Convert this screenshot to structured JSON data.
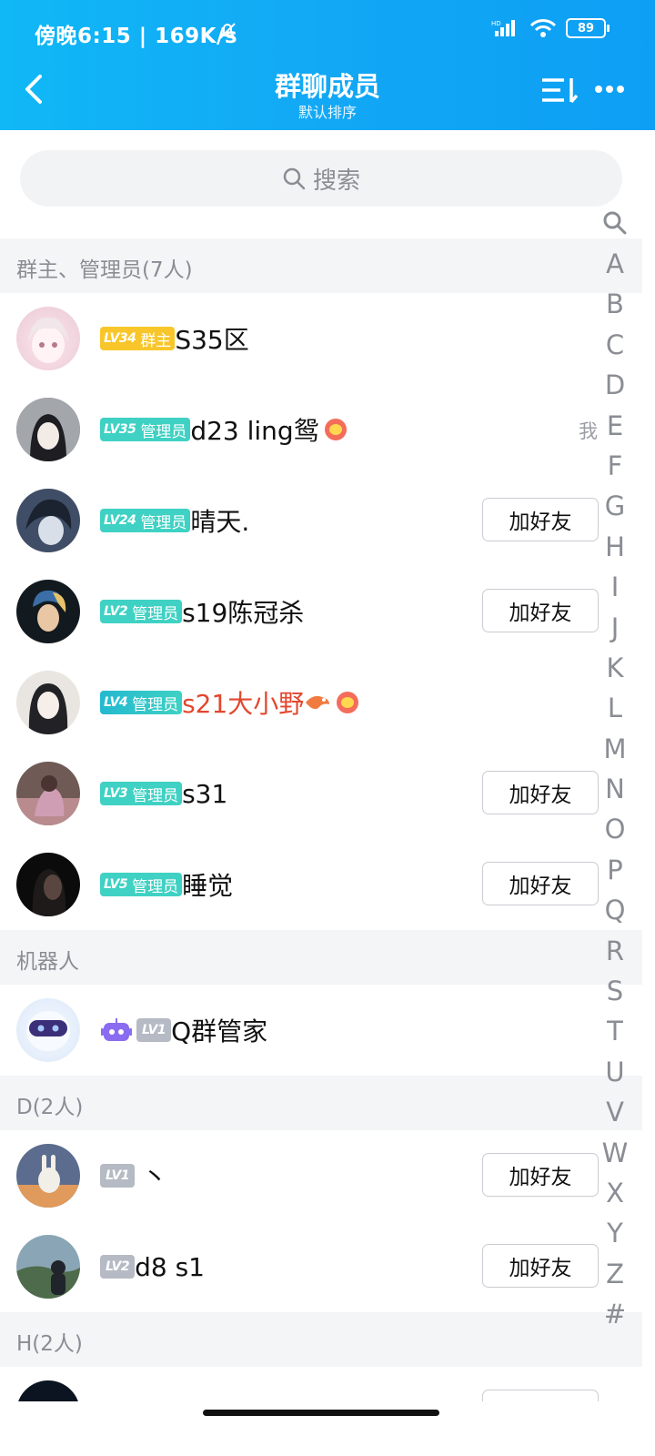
{
  "status_bar": {
    "time": "傍晚6:15 | 169K/s",
    "battery": "89"
  },
  "header": {
    "title": "群聊成员",
    "subtitle": "默认排序"
  },
  "search": {
    "placeholder": "搜索"
  },
  "sections": [
    {
      "label": "群主、管理员(7人)"
    },
    {
      "label": "机器人"
    },
    {
      "label": "D(2人)"
    },
    {
      "label": "H(2人)"
    }
  ],
  "members": [
    {
      "level": "LV34",
      "role": "群主",
      "name": "S35区"
    },
    {
      "level": "LV35",
      "role": "管理员",
      "name": "d23   ling鸳",
      "tag": "我"
    },
    {
      "level": "LV24",
      "role": "管理员",
      "name": "晴天.",
      "button": "加好友"
    },
    {
      "level": "LV2",
      "role": "管理员",
      "name": "s19陈冠杀",
      "button": "加好友"
    },
    {
      "level": "LV4",
      "role": "管理员",
      "name": "s21大小野"
    },
    {
      "level": "LV3",
      "role": "管理员",
      "name": "s31",
      "button": "加好友"
    },
    {
      "level": "LV5",
      "role": "管理员",
      "name": "睡觉",
      "button": "加好友"
    }
  ],
  "bots": [
    {
      "level": "LV1",
      "name": "Q群管家"
    }
  ],
  "d_members": [
    {
      "level": "LV1",
      "name": "丶",
      "button": "加好友"
    },
    {
      "level": "LV2",
      "name": "d8 s1",
      "button": "加好友"
    }
  ],
  "index_letters": [
    "A",
    "B",
    "C",
    "D",
    "E",
    "F",
    "G",
    "H",
    "I",
    "J",
    "K",
    "L",
    "M",
    "N",
    "O",
    "P",
    "Q",
    "R",
    "S",
    "T",
    "U",
    "V",
    "W",
    "X",
    "Y",
    "Z",
    "#"
  ],
  "colors": {
    "header": "#12a8f5",
    "owner_badge": "#f8c62a",
    "admin_badge": "#3fd1c3",
    "red_name": "#e2472e"
  }
}
